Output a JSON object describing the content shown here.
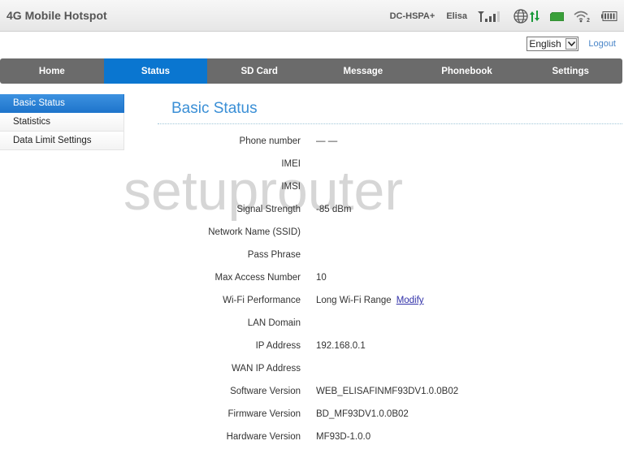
{
  "header": {
    "title": "4G Mobile Hotspot",
    "network_type": "DC-HSPA+",
    "operator": "Elisa",
    "icons": {
      "signal": "signal-bars-icon",
      "internet": "globe-icon",
      "data_transfer": "up-down-arrows-icon",
      "sim": "sim-card-icon",
      "wifi": "wifi-icon",
      "wifi_clients": "2",
      "battery": "battery-icon"
    },
    "colors": {
      "data_arrows": "#1a9a3a",
      "sim": "#3aa03a"
    }
  },
  "language": {
    "selected": "English"
  },
  "logout_label": "Logout",
  "nav": {
    "items": [
      {
        "label": "Home"
      },
      {
        "label": "Status",
        "active": true
      },
      {
        "label": "SD Card"
      },
      {
        "label": "Message"
      },
      {
        "label": "Phonebook"
      },
      {
        "label": "Settings"
      }
    ],
    "active_color": "#0a76d0",
    "bar_color": "#6b6b6b"
  },
  "sidebar": {
    "items": [
      {
        "label": "Basic Status",
        "active": true
      },
      {
        "label": "Statistics"
      },
      {
        "label": "Data Limit Settings"
      }
    ]
  },
  "main": {
    "title": "Basic Status",
    "rows": [
      {
        "label": "Phone number",
        "value": "— —"
      },
      {
        "label": "IMEI",
        "value": ""
      },
      {
        "label": "IMSI",
        "value": ""
      },
      {
        "label": "Signal Strength",
        "value": "-85 dBm"
      },
      {
        "label": "Network Name (SSID)",
        "value": ""
      },
      {
        "label": "Pass Phrase",
        "value": ""
      },
      {
        "label": "Max Access Number",
        "value": "10"
      },
      {
        "label": "Wi-Fi Performance",
        "value": "Long Wi-Fi Range",
        "link": "Modify"
      },
      {
        "label": "LAN Domain",
        "value": ""
      },
      {
        "label": "IP Address",
        "value": "192.168.0.1"
      },
      {
        "label": "WAN IP Address",
        "value": ""
      },
      {
        "label": "Software Version",
        "value": "WEB_ELISAFINMF93DV1.0.0B02"
      },
      {
        "label": "Firmware Version",
        "value": "BD_MF93DV1.0.0B02"
      },
      {
        "label": "Hardware Version",
        "value": "MF93D-1.0.0"
      }
    ]
  },
  "watermark": "setuprouter"
}
